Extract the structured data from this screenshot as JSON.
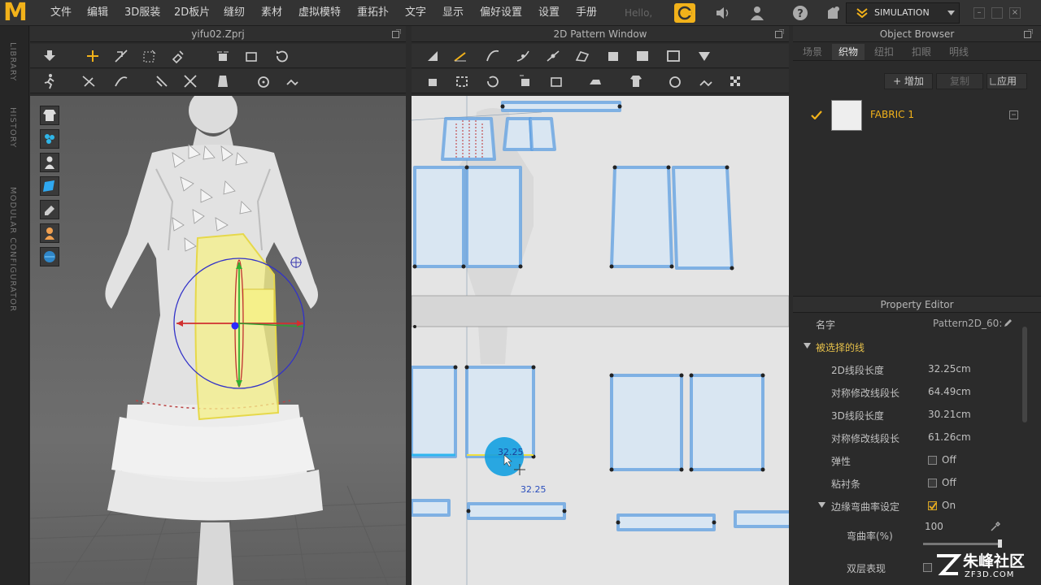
{
  "menubar": {
    "items": [
      "文件",
      "编辑",
      "3D服装",
      "2D板片",
      "缝纫",
      "素材",
      "虚拟模特",
      "重拓扑",
      "文字",
      "显示",
      "偏好设置",
      "设置",
      "手册"
    ],
    "hello": "Hello,",
    "simulation_label": "SIMULATION"
  },
  "sidebar": {
    "library": "LIBRARY",
    "history": "HISTORY",
    "modular": "MODULAR CONFIGURATOR"
  },
  "view3d": {
    "title": "yifu02.Zprj"
  },
  "view2d": {
    "title": "2D Pattern Window",
    "segment_value": "32.25",
    "segment_value_below": "32.25"
  },
  "object_browser": {
    "title": "Object Browser",
    "tabs": [
      "场景",
      "织物",
      "纽扣",
      "扣眼",
      "明线"
    ],
    "active_tab": 1,
    "add_label": "+ 增加",
    "copy_label": "复制",
    "apply_label": "应用",
    "fabric_name": "FABRIC 1"
  },
  "property_editor": {
    "title": "Property Editor",
    "name_label": "名字",
    "name_value": "Pattern2D_60:",
    "section": "被选择的线",
    "rows": [
      {
        "label": "2D线段长度",
        "value": "32.25cm"
      },
      {
        "label": "对称修改线段长",
        "value": "64.49cm"
      },
      {
        "label": "3D线段长度",
        "value": "30.21cm"
      },
      {
        "label": "对称修改线段长",
        "value": "61.26cm"
      }
    ],
    "elastic_label": "弹性",
    "elastic_value": "Off",
    "bind_label": "粘衬条",
    "bind_value": "Off",
    "curve_label": "边缘弯曲率设定",
    "curve_value": "On",
    "curvature_label": "弯曲率(%)",
    "curvature_value": "100",
    "double_label": "双层表现"
  },
  "watermark": {
    "brand": "朱峰社区",
    "url": "ZF3D.COM"
  },
  "colors": {
    "accent": "#f2b21a",
    "pattern_blue": "#4a90d9",
    "highlight": "#f5f08a"
  }
}
